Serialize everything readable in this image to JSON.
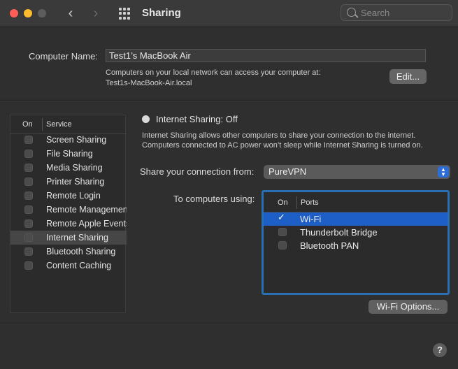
{
  "window": {
    "title": "Sharing",
    "search_placeholder": "Search"
  },
  "computer_name": {
    "label": "Computer Name:",
    "value": "Test1’s MacBook Air",
    "description_line1": "Computers on your local network can access your computer at:",
    "description_line2": "Test1s-MacBook-Air.local",
    "edit_label": "Edit..."
  },
  "services": {
    "header_on": "On",
    "header_service": "Service",
    "selected_index": 7,
    "items": [
      {
        "label": "Screen Sharing",
        "on": false
      },
      {
        "label": "File Sharing",
        "on": false
      },
      {
        "label": "Media Sharing",
        "on": false
      },
      {
        "label": "Printer Sharing",
        "on": false
      },
      {
        "label": "Remote Login",
        "on": false
      },
      {
        "label": "Remote Management",
        "on": false
      },
      {
        "label": "Remote Apple Events",
        "on": false
      },
      {
        "label": "Internet Sharing",
        "on": false
      },
      {
        "label": "Bluetooth Sharing",
        "on": false
      },
      {
        "label": "Content Caching",
        "on": false
      }
    ]
  },
  "internet_sharing": {
    "status_title": "Internet Sharing: Off",
    "description": "Internet Sharing allows other computers to share your connection to the internet. Computers connected to AC power won’t sleep while Internet Sharing is turned on.",
    "share_from_label": "Share your connection from:",
    "share_from_value": "PureVPN",
    "to_computers_label": "To computers using:",
    "ports_header_on": "On",
    "ports_header_ports": "Ports",
    "ports": [
      {
        "label": "Wi-Fi",
        "on": true,
        "selected": true
      },
      {
        "label": "Thunderbolt Bridge",
        "on": false,
        "selected": false
      },
      {
        "label": "Bluetooth PAN",
        "on": false,
        "selected": false
      }
    ],
    "wifi_options_label": "Wi-Fi Options..."
  },
  "help_label": "?",
  "colors": {
    "accent": "#1e5fc7",
    "focus_ring": "#2a6fb4",
    "background": "#2f2f2f"
  }
}
